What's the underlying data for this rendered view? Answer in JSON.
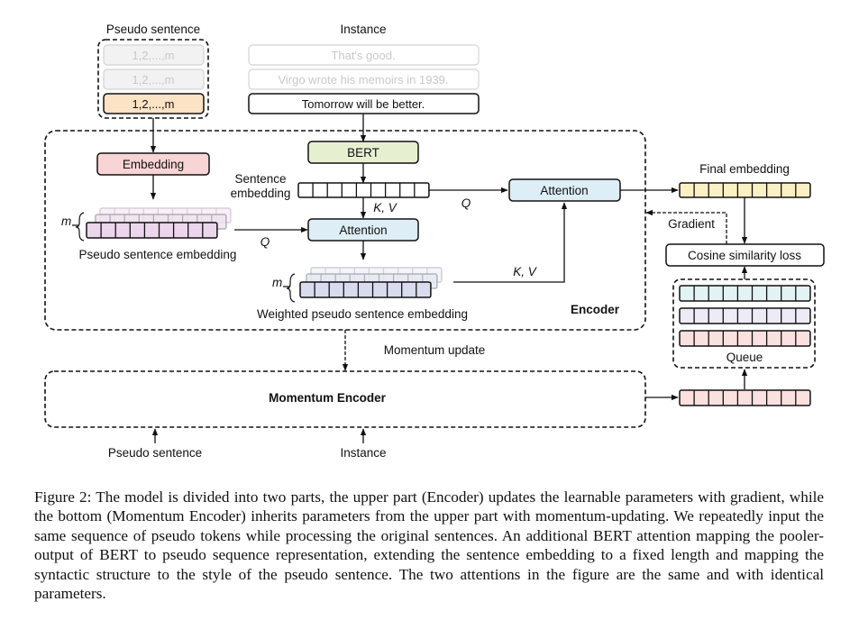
{
  "labels": {
    "pseudo_sentence_title": "Pseudo sentence",
    "instance_title": "Instance",
    "pseudo_tokens": [
      "1,2,...,m",
      "1,2,...,m",
      "1,2,...,m"
    ],
    "instances": [
      "That's good.",
      "Virgo wrote his memoirs in 1939.",
      "Tomorrow will be better."
    ],
    "embedding": "Embedding",
    "bert": "BERT",
    "sentence_embedding_line1": "Sentence",
    "sentence_embedding_line2": "embedding",
    "attention_lower": "Attention",
    "attention_upper": "Attention",
    "kv_1": "K, V",
    "kv_2": "K, V",
    "q_1": "Q",
    "q_2": "Q",
    "m_1": "m",
    "m_2": "m",
    "pseudo_sentence_embedding": "Pseudo sentence embedding",
    "weighted_pseudo_sentence_embedding": "Weighted pseudo sentence embedding",
    "encoder": "Encoder",
    "final_embedding": "Final embedding",
    "gradient": "Gradient",
    "cosine_similarity_loss": "Cosine similarity loss",
    "queue": "Queue",
    "momentum_update": "Momentum update",
    "momentum_encoder": "Momentum Encoder",
    "bottom_pseudo_sentence": "Pseudo sentence",
    "bottom_instance": "Instance"
  },
  "colors": {
    "pseudo_active": "#fde3c5",
    "embedding": "#f9d4d4",
    "bert": "#e6f0d1",
    "attention": "#deeef6",
    "pseudo_embedding": "#ecd6ec",
    "weighted_embedding": "#d9dcee",
    "final_embedding": "#fbf0c3",
    "queue_row1": "#e3f2f3",
    "queue_row2": "#ecebf6",
    "queue_row3": "#fbe0e0",
    "momentum_output": "#fbe0e0"
  },
  "caption": "Figure 2: The model is divided into two parts, the upper part (Encoder) updates the learnable parameters with gradient, while the bottom (Momentum Encoder) inherits parameters from the upper part with momentum-updating. We repeatedly input the same sequence of pseudo tokens while processing the original sentences. An additional BERT attention mapping the pooler-output of BERT to pseudo sequence representation, extending the sentence embedding to a fixed length and mapping the syntactic structure to the style of the pseudo sentence. The two attentions in the figure are the same and with identical parameters."
}
